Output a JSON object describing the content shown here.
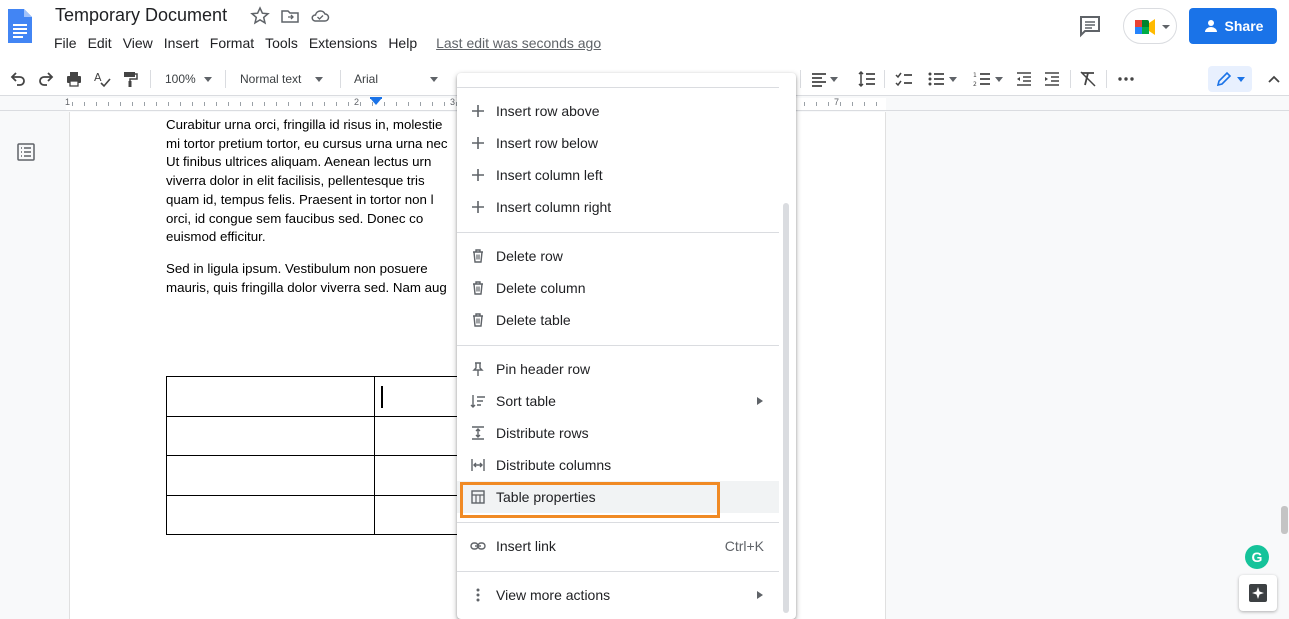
{
  "app": {
    "title": "Temporary Document",
    "last_edit": "Last edit was seconds ago",
    "share_label": "Share",
    "brand_color": "#1a73e8"
  },
  "menu": [
    "File",
    "Edit",
    "View",
    "Insert",
    "Format",
    "Tools",
    "Extensions",
    "Help"
  ],
  "toolbar": {
    "zoom": "100%",
    "style": "Normal text",
    "font": "Arial",
    "icons": [
      "undo-icon",
      "redo-icon",
      "print-icon",
      "spellcheck-icon",
      "paint-format-icon",
      "align-icon",
      "line-spacing-icon",
      "checklist-icon",
      "bulleted-list-icon",
      "numbered-list-icon",
      "decrease-indent-icon",
      "increase-indent-icon",
      "clear-formatting-icon",
      "more-icon",
      "edit-mode-icon",
      "collapse-icon"
    ]
  },
  "ruler": {
    "numbers": [
      "1",
      "2",
      "3",
      "7"
    ]
  },
  "document": {
    "paragraph1": [
      "Curabitur urna orci, fringilla id risus in, molestie",
      "mi tortor pretium tortor, eu cursus urna urna nec",
      "Ut finibus ultrices aliquam. Aenean lectus urn",
      "viverra dolor in elit facilisis, pellentesque tris",
      "quam id, tempus felis. Praesent in tortor non l",
      "orci, id congue sem faucibus sed. Donec co",
      "euismod efficitur."
    ],
    "paragraph2": [
      "Sed in ligula ipsum. Vestibulum non posuere",
      "mauris, quis fringilla dolor viverra sed. Nam aug"
    ],
    "table_rows": 4,
    "table_cols": 2
  },
  "context_menu": {
    "groups": [
      [
        {
          "label": "Insert row above",
          "icon": "plus-icon"
        },
        {
          "label": "Insert row below",
          "icon": "plus-icon"
        },
        {
          "label": "Insert column left",
          "icon": "plus-icon"
        },
        {
          "label": "Insert column right",
          "icon": "plus-icon"
        }
      ],
      [
        {
          "label": "Delete row",
          "icon": "trash-icon"
        },
        {
          "label": "Delete column",
          "icon": "trash-icon"
        },
        {
          "label": "Delete table",
          "icon": "trash-icon"
        }
      ],
      [
        {
          "label": "Pin header row",
          "icon": "pin-icon"
        },
        {
          "label": "Sort table",
          "icon": "sort-icon",
          "submenu": true
        },
        {
          "label": "Distribute rows",
          "icon": "distribute-rows-icon"
        },
        {
          "label": "Distribute columns",
          "icon": "distribute-columns-icon"
        },
        {
          "label": "Table properties",
          "icon": "table-icon",
          "highlighted": true
        }
      ],
      [
        {
          "label": "Insert link",
          "icon": "link-icon",
          "shortcut": "Ctrl+K"
        }
      ],
      [
        {
          "label": "View more actions",
          "icon": "more-vert-icon",
          "submenu": true
        }
      ]
    ],
    "highlight_color": "#f08a24"
  },
  "side": {
    "grammarly": "G"
  }
}
